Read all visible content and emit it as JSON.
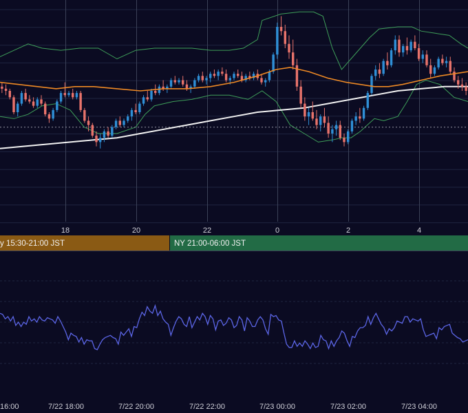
{
  "colors": {
    "background": "#0b0b22",
    "grid": "#1f2540",
    "grid_vertical": "#3c4258",
    "candle_up": "#2f8fd6",
    "candle_down": "#e8736b",
    "bollinger": "#3fa05a",
    "ma_short": "#f08a24",
    "ma_long": "#f2f2f2",
    "oscillator": "#5c66e8",
    "session_tokyo": "#8a5a14",
    "session_ny": "#226b45",
    "dotted_level": "#9a9aa8"
  },
  "chart_data": [
    {
      "type": "candlestick",
      "x_ticks": [
        "18",
        "20",
        "22",
        "0",
        "2",
        "4"
      ],
      "y_range": [
        0,
        100
      ],
      "dotted_level": 43,
      "candles_ohlc": [
        [
          62,
          64,
          59,
          61
        ],
        [
          61,
          63,
          58,
          60
        ],
        [
          60,
          61,
          56,
          57
        ],
        [
          57,
          58,
          49,
          50
        ],
        [
          50,
          55,
          48,
          54
        ],
        [
          54,
          60,
          53,
          59
        ],
        [
          59,
          61,
          55,
          56
        ],
        [
          56,
          58,
          54,
          55
        ],
        [
          55,
          57,
          52,
          53
        ],
        [
          53,
          57,
          52,
          56
        ],
        [
          56,
          58,
          53,
          54
        ],
        [
          54,
          55,
          48,
          49
        ],
        [
          49,
          50,
          45,
          47
        ],
        [
          47,
          52,
          46,
          51
        ],
        [
          51,
          56,
          50,
          55
        ],
        [
          55,
          60,
          54,
          59
        ],
        [
          59,
          64,
          57,
          58
        ],
        [
          58,
          60,
          57,
          59
        ],
        [
          59,
          61,
          56,
          57
        ],
        [
          57,
          60,
          56,
          59
        ],
        [
          59,
          60,
          50,
          51
        ],
        [
          51,
          52,
          45,
          46
        ],
        [
          46,
          48,
          41,
          44
        ],
        [
          44,
          45,
          38,
          39
        ],
        [
          39,
          41,
          34,
          36
        ],
        [
          36,
          40,
          33,
          38
        ],
        [
          38,
          42,
          36,
          41
        ],
        [
          41,
          43,
          38,
          39
        ],
        [
          39,
          44,
          38,
          43
        ],
        [
          43,
          47,
          42,
          46
        ],
        [
          46,
          48,
          43,
          44
        ],
        [
          44,
          47,
          43,
          46
        ],
        [
          46,
          49,
          45,
          48
        ],
        [
          48,
          52,
          46,
          51
        ],
        [
          51,
          54,
          49,
          50
        ],
        [
          50,
          55,
          49,
          54
        ],
        [
          54,
          58,
          53,
          57
        ],
        [
          57,
          60,
          55,
          56
        ],
        [
          56,
          61,
          55,
          60
        ],
        [
          60,
          63,
          58,
          59
        ],
        [
          59,
          63,
          58,
          62
        ],
        [
          62,
          65,
          60,
          61
        ],
        [
          61,
          63,
          59,
          62
        ],
        [
          62,
          66,
          61,
          65
        ],
        [
          65,
          67,
          63,
          64
        ],
        [
          64,
          66,
          63,
          65
        ],
        [
          65,
          67,
          62,
          63
        ],
        [
          63,
          65,
          60,
          61
        ],
        [
          61,
          63,
          59,
          62
        ],
        [
          62,
          66,
          61,
          65
        ],
        [
          65,
          68,
          64,
          67
        ],
        [
          67,
          69,
          64,
          65
        ],
        [
          65,
          67,
          63,
          66
        ],
        [
          66,
          69,
          64,
          68
        ],
        [
          68,
          70,
          66,
          67
        ],
        [
          67,
          70,
          65,
          69
        ],
        [
          69,
          71,
          67,
          68
        ],
        [
          68,
          70,
          64,
          65
        ],
        [
          65,
          67,
          63,
          66
        ],
        [
          66,
          69,
          65,
          68
        ],
        [
          68,
          70,
          66,
          67
        ],
        [
          67,
          69,
          64,
          65
        ],
        [
          65,
          68,
          64,
          67
        ],
        [
          67,
          69,
          65,
          66
        ],
        [
          66,
          69,
          65,
          68
        ],
        [
          68,
          70,
          65,
          66
        ],
        [
          66,
          68,
          63,
          64
        ],
        [
          64,
          66,
          62,
          65
        ],
        [
          65,
          70,
          64,
          69
        ],
        [
          69,
          78,
          68,
          77
        ],
        [
          77,
          92,
          75,
          90
        ],
        [
          90,
          95,
          86,
          88
        ],
        [
          88,
          91,
          80,
          82
        ],
        [
          82,
          86,
          75,
          78
        ],
        [
          78,
          84,
          70,
          72
        ],
        [
          72,
          75,
          60,
          62
        ],
        [
          62,
          65,
          52,
          54
        ],
        [
          54,
          57,
          46,
          48
        ],
        [
          48,
          52,
          44,
          50
        ],
        [
          50,
          55,
          46,
          47
        ],
        [
          47,
          51,
          42,
          44
        ],
        [
          44,
          49,
          41,
          48
        ],
        [
          48,
          52,
          43,
          45
        ],
        [
          45,
          48,
          38,
          40
        ],
        [
          40,
          44,
          36,
          42
        ],
        [
          42,
          46,
          39,
          44
        ],
        [
          44,
          46,
          37,
          38
        ],
        [
          38,
          40,
          34,
          36
        ],
        [
          36,
          42,
          35,
          41
        ],
        [
          41,
          47,
          40,
          46
        ],
        [
          46,
          50,
          44,
          48
        ],
        [
          48,
          52,
          45,
          47
        ],
        [
          47,
          53,
          46,
          52
        ],
        [
          52,
          60,
          51,
          59
        ],
        [
          59,
          68,
          58,
          67
        ],
        [
          67,
          72,
          65,
          70
        ],
        [
          70,
          73,
          66,
          68
        ],
        [
          68,
          75,
          67,
          74
        ],
        [
          74,
          78,
          70,
          72
        ],
        [
          72,
          80,
          71,
          79
        ],
        [
          79,
          86,
          77,
          84
        ],
        [
          84,
          86,
          76,
          78
        ],
        [
          78,
          82,
          76,
          81
        ],
        [
          81,
          85,
          77,
          79
        ],
        [
          79,
          84,
          78,
          83
        ],
        [
          83,
          86,
          79,
          80
        ],
        [
          80,
          82,
          74,
          75
        ],
        [
          75,
          79,
          73,
          77
        ],
        [
          77,
          79,
          71,
          72
        ],
        [
          72,
          75,
          66,
          68
        ],
        [
          68,
          72,
          67,
          71
        ],
        [
          71,
          76,
          70,
          75
        ],
        [
          75,
          77,
          72,
          73
        ],
        [
          73,
          76,
          71,
          74
        ],
        [
          74,
          76,
          68,
          69
        ],
        [
          69,
          71,
          64,
          65
        ],
        [
          65,
          67,
          61,
          63
        ],
        [
          63,
          66,
          60,
          62
        ],
        [
          62,
          64,
          58,
          60
        ]
      ],
      "bollinger_upper": [
        [
          0,
          76
        ],
        [
          0.03,
          79
        ],
        [
          0.06,
          82
        ],
        [
          0.09,
          80
        ],
        [
          0.13,
          79
        ],
        [
          0.17,
          80
        ],
        [
          0.21,
          80
        ],
        [
          0.25,
          75
        ],
        [
          0.29,
          79
        ],
        [
          0.33,
          80
        ],
        [
          0.37,
          80
        ],
        [
          0.41,
          80
        ],
        [
          0.45,
          79
        ],
        [
          0.49,
          79
        ],
        [
          0.52,
          80
        ],
        [
          0.55,
          84
        ],
        [
          0.56,
          93
        ],
        [
          0.6,
          96
        ],
        [
          0.64,
          97
        ],
        [
          0.67,
          97
        ],
        [
          0.69,
          95
        ],
        [
          0.71,
          80
        ],
        [
          0.73,
          70
        ],
        [
          0.75,
          75
        ],
        [
          0.77,
          80
        ],
        [
          0.79,
          85
        ],
        [
          0.81,
          89
        ],
        [
          0.85,
          90
        ],
        [
          0.88,
          90
        ],
        [
          0.9,
          88
        ],
        [
          0.93,
          87
        ],
        [
          0.96,
          86
        ],
        [
          0.985,
          82
        ],
        [
          1,
          80
        ]
      ],
      "bollinger_lower": [
        [
          0,
          48
        ],
        [
          0.03,
          47
        ],
        [
          0.06,
          49
        ],
        [
          0.09,
          53
        ],
        [
          0.12,
          54
        ],
        [
          0.15,
          51
        ],
        [
          0.18,
          43
        ],
        [
          0.21,
          40
        ],
        [
          0.25,
          40
        ],
        [
          0.29,
          43
        ],
        [
          0.31,
          49
        ],
        [
          0.33,
          53
        ],
        [
          0.37,
          55
        ],
        [
          0.41,
          56
        ],
        [
          0.45,
          58
        ],
        [
          0.49,
          58
        ],
        [
          0.53,
          56
        ],
        [
          0.56,
          60
        ],
        [
          0.59,
          55
        ],
        [
          0.62,
          44
        ],
        [
          0.65,
          40
        ],
        [
          0.68,
          36
        ],
        [
          0.71,
          37
        ],
        [
          0.73,
          38
        ],
        [
          0.75,
          38
        ],
        [
          0.77,
          41
        ],
        [
          0.8,
          47
        ],
        [
          0.82,
          46
        ],
        [
          0.85,
          48
        ],
        [
          0.87,
          55
        ],
        [
          0.89,
          63
        ],
        [
          0.91,
          65
        ],
        [
          0.94,
          63
        ],
        [
          0.97,
          57
        ],
        [
          1,
          55
        ]
      ],
      "ma_short": [
        [
          0,
          64
        ],
        [
          0.04,
          63
        ],
        [
          0.08,
          62
        ],
        [
          0.12,
          61
        ],
        [
          0.16,
          62
        ],
        [
          0.2,
          62
        ],
        [
          0.25,
          61
        ],
        [
          0.3,
          60
        ],
        [
          0.35,
          61
        ],
        [
          0.4,
          61
        ],
        [
          0.45,
          62
        ],
        [
          0.5,
          64
        ],
        [
          0.55,
          67
        ],
        [
          0.59,
          70
        ],
        [
          0.62,
          71
        ],
        [
          0.66,
          69
        ],
        [
          0.7,
          66
        ],
        [
          0.74,
          64
        ],
        [
          0.77,
          63
        ],
        [
          0.8,
          62
        ],
        [
          0.83,
          62
        ],
        [
          0.86,
          63
        ],
        [
          0.9,
          65
        ],
        [
          0.94,
          67
        ],
        [
          0.97,
          68
        ],
        [
          1,
          69
        ]
      ],
      "ma_long": [
        [
          0,
          33
        ],
        [
          0.05,
          34
        ],
        [
          0.1,
          35
        ],
        [
          0.15,
          36
        ],
        [
          0.2,
          37
        ],
        [
          0.25,
          38
        ],
        [
          0.3,
          40
        ],
        [
          0.35,
          42
        ],
        [
          0.4,
          44
        ],
        [
          0.45,
          46
        ],
        [
          0.5,
          48
        ],
        [
          0.55,
          50
        ],
        [
          0.6,
          51
        ],
        [
          0.65,
          52
        ],
        [
          0.7,
          54
        ],
        [
          0.75,
          56
        ],
        [
          0.8,
          58
        ],
        [
          0.85,
          60
        ],
        [
          0.9,
          61
        ],
        [
          0.95,
          62
        ],
        [
          1,
          62
        ]
      ]
    },
    {
      "type": "line",
      "x_ticks": [
        "16:00",
        "7/22 18:00",
        "7/22 20:00",
        "7/22 22:00",
        "7/23 00:00",
        "7/23 02:00",
        "7/23 04:00"
      ],
      "y_range": [
        0,
        100
      ],
      "values": [
        58,
        57,
        53,
        55,
        51,
        55,
        47,
        50,
        46,
        50,
        48,
        55,
        51,
        53,
        50,
        55,
        52,
        51,
        54,
        53,
        52,
        49,
        55,
        51,
        46,
        41,
        34,
        40,
        38,
        37,
        32,
        36,
        30,
        34,
        33,
        33,
        26,
        25,
        30,
        34,
        36,
        37,
        38,
        36,
        35,
        30,
        41,
        38,
        41,
        44,
        37,
        46,
        45,
        53,
        59,
        56,
        64,
        60,
        58,
        65,
        56,
        60,
        53,
        50,
        48,
        38,
        45,
        51,
        55,
        53,
        48,
        46,
        55,
        45,
        50,
        55,
        52,
        58,
        55,
        48,
        56,
        53,
        43,
        51,
        52,
        47,
        49,
        54,
        52,
        45,
        47,
        55,
        52,
        42,
        54,
        51,
        46,
        46,
        52,
        55,
        52,
        44,
        39,
        57,
        55,
        56,
        52,
        51,
        40,
        30,
        27,
        27,
        33,
        28,
        31,
        28,
        33,
        30,
        26,
        31,
        27,
        28,
        38,
        34,
        33,
        26,
        33,
        28,
        33,
        36,
        42,
        40,
        33,
        28,
        37,
        36,
        42,
        45,
        45,
        47,
        55,
        48,
        54,
        58,
        53,
        48,
        45,
        39,
        44,
        42,
        45,
        51,
        50,
        49,
        55,
        55,
        50,
        53,
        52,
        51,
        53,
        43,
        37,
        38,
        39,
        40,
        35,
        45,
        43,
        46,
        47,
        48,
        40,
        38,
        36,
        35,
        32,
        33,
        34
      ]
    }
  ],
  "sessions": [
    {
      "label": "y 15:30-21:00 JST"
    },
    {
      "label": "NY 21:00-06:00 JST"
    }
  ]
}
